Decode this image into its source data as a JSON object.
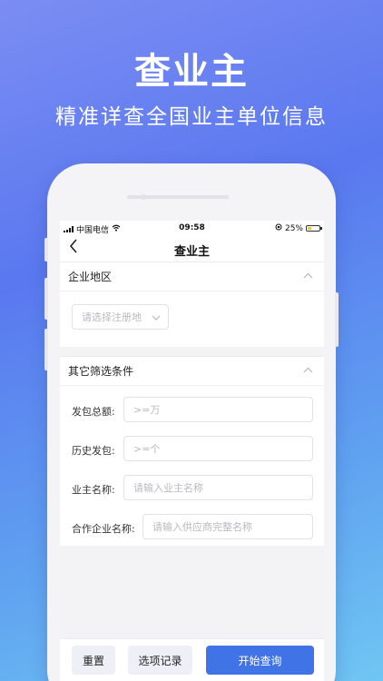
{
  "hero": {
    "title": "查业主",
    "subtitle": "精准详查全国业主单位信息"
  },
  "status_bar": {
    "carrier": "中国电信",
    "time": "09:58",
    "battery": "25%",
    "battery_level": 0.25
  },
  "nav": {
    "back_icon": "chevron-left-icon",
    "title": "查业主"
  },
  "region_section": {
    "title": "企业地区",
    "select_placeholder": "请选择注册地"
  },
  "filter_section": {
    "title": "其它筛选条件",
    "fields": [
      {
        "label": "发包总额:",
        "placeholder": ">=万"
      },
      {
        "label": "历史发包:",
        "placeholder": ">=个"
      },
      {
        "label": "业主名称:",
        "placeholder": "请输入业主名称"
      },
      {
        "label": "合作企业名称:",
        "placeholder": "请输入供应商完整名称"
      }
    ]
  },
  "buttons": {
    "reset": "重置",
    "history": "选项记录",
    "search": "开始查询"
  },
  "colors": {
    "primary": "#3f73e6",
    "battery": "#f5c12e"
  }
}
